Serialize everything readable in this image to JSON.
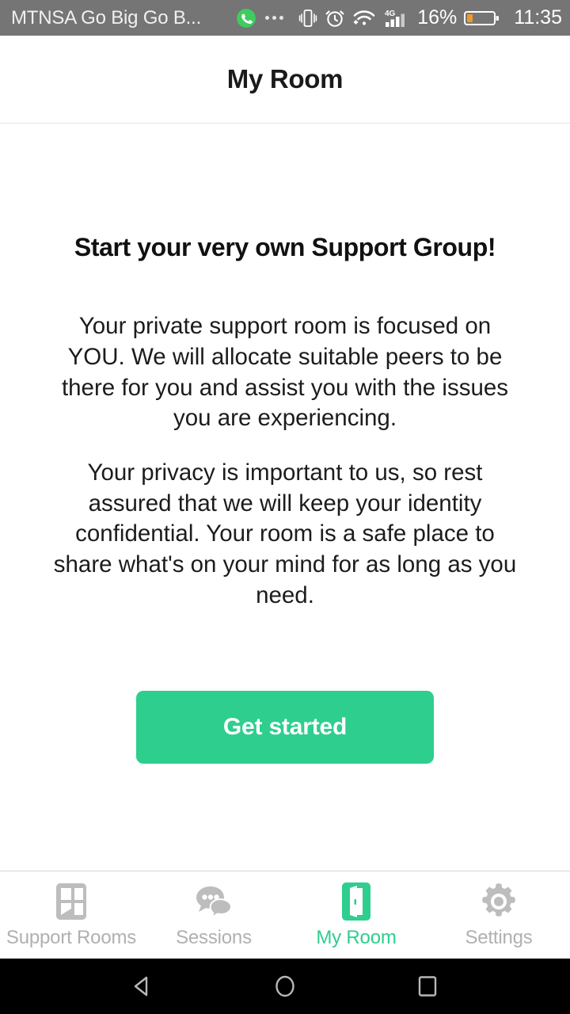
{
  "statusbar": {
    "carrier": "MTNSA Go Big Go B...",
    "battery_percent": "16%",
    "time": "11:35",
    "network_type": "4G",
    "icons": [
      "whatsapp-icon",
      "overflow-dots-icon",
      "vibrate-icon",
      "alarm-icon",
      "wifi-icon",
      "signal-icon",
      "battery-icon"
    ],
    "colors": {
      "background": "#757575",
      "text": "#ffffff",
      "battery_fill": "#F09A2B"
    }
  },
  "header": {
    "title": "My Room"
  },
  "main": {
    "headline": "Start your very own Support Group!",
    "paragraph_1": "Your private support room is focused on YOU. We will allocate suitable peers to be there for you and assist you with the issues you are experiencing.",
    "paragraph_2": "Your privacy is important to us, so rest assured that we will keep your identity confidential. Your room is a safe place to share what's on your mind for as long as you need.",
    "cta_label": "Get started"
  },
  "tabbar": {
    "active_index": 2,
    "items": [
      {
        "label": "Support Rooms",
        "icon": "grid-icon"
      },
      {
        "label": "Sessions",
        "icon": "chat-bubbles-icon"
      },
      {
        "label": "My Room",
        "icon": "door-icon"
      },
      {
        "label": "Settings",
        "icon": "gear-icon"
      }
    ]
  },
  "navbar": {
    "items": [
      {
        "name": "back-button",
        "icon": "triangle-back-icon"
      },
      {
        "name": "home-button",
        "icon": "circle-home-icon"
      },
      {
        "name": "recents-button",
        "icon": "square-recents-icon"
      }
    ]
  },
  "theme": {
    "accent": "#2ECE8E",
    "inactive": "#b0b0b0",
    "text": "#1a1a1a",
    "statusbar_bg": "#757575"
  }
}
